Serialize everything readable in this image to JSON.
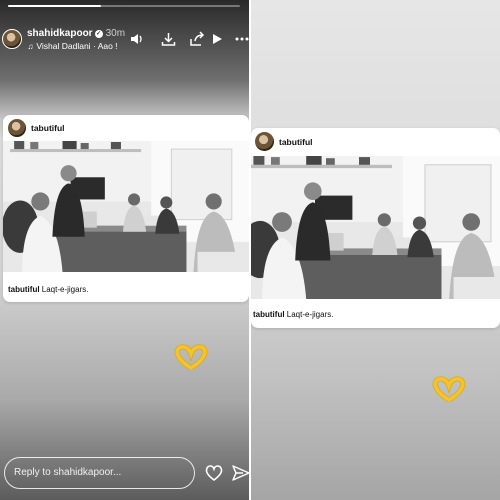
{
  "left_story": {
    "progress_fraction": 0.4,
    "username": "shahidkapoor",
    "time": "30m",
    "music_artist": "Vishal Dadlani",
    "music_song": "Aao !",
    "icons": [
      "volume-icon",
      "download-icon",
      "share-icon",
      "play-icon",
      "more-icon"
    ],
    "card": {
      "username": "tabutiful",
      "caption_user": "tabutiful",
      "caption_text": "Laqt-e-jigars."
    },
    "reply_placeholder": "Reply to shahidkapoor..."
  },
  "right_story": {
    "card": {
      "username": "tabutiful",
      "caption_user": "tabutiful",
      "caption_text": "Laqt-e-jigars."
    }
  },
  "colors": {
    "card_bg": "#ffffff",
    "emoji_yellow": "#f4c430"
  }
}
